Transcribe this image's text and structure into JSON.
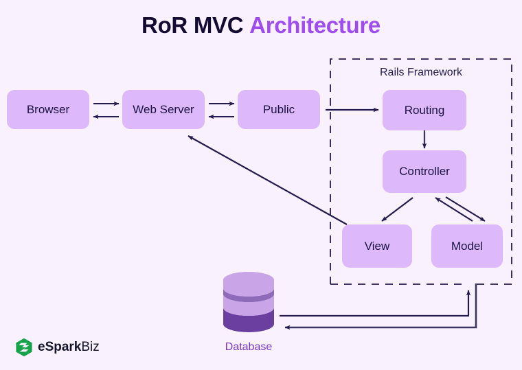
{
  "title": {
    "primary": "RoR MVC",
    "accent": "Architecture"
  },
  "frame": {
    "label": "Rails Framework"
  },
  "nodes": [
    {
      "id": "browser",
      "label": "Browser"
    },
    {
      "id": "web-server",
      "label": "Web Server"
    },
    {
      "id": "public",
      "label": "Public"
    },
    {
      "id": "routing",
      "label": "Routing"
    },
    {
      "id": "controller",
      "label": "Controller"
    },
    {
      "id": "view",
      "label": "View"
    },
    {
      "id": "model",
      "label": "Model"
    }
  ],
  "database": {
    "label": "Database"
  },
  "logo": {
    "brand_bold": "eSpark",
    "brand_light": "Biz",
    "icon": "espark-hexagon-logo"
  },
  "colors": {
    "background": "#F9F2FE",
    "node_fill": "#DDB8FA",
    "node_text": "#1B1145",
    "title_dark": "#140B33",
    "title_accent": "#9E4CF0",
    "arrow": "#231A4D",
    "frame_border": "#231A4D",
    "db_light": "#C9A5E8",
    "db_mid": "#8E6BB8",
    "db_dark": "#6B3FA0",
    "db_label": "#7B36C4",
    "logo_green": "#16A34A"
  }
}
